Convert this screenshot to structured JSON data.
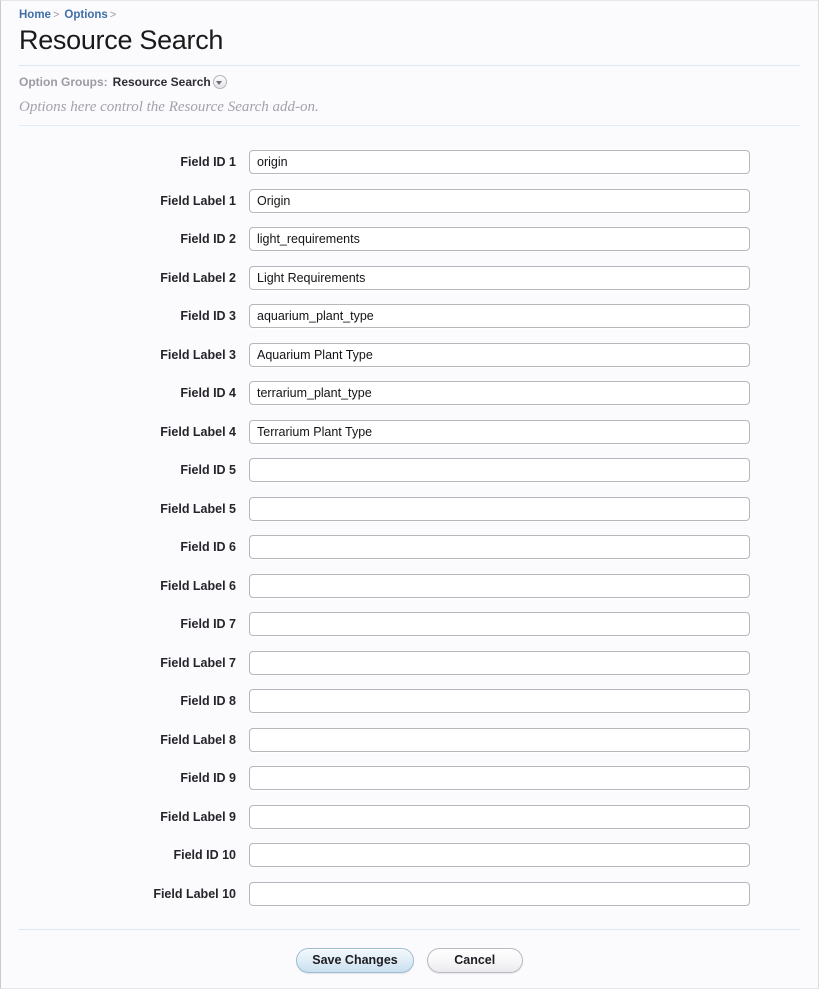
{
  "breadcrumb": {
    "items": [
      {
        "label": "Home",
        "separator": ">"
      },
      {
        "label": "Options",
        "separator": ">"
      }
    ]
  },
  "header": {
    "title": "Resource Search"
  },
  "option_groups": {
    "label": "Option Groups:",
    "selected": "Resource Search",
    "dropdown_icon": "chevron-down-circle-icon"
  },
  "description": "Options here control the Resource Search add-on.",
  "form": {
    "rows": [
      {
        "label": "Field ID 1",
        "value": "origin"
      },
      {
        "label": "Field Label 1",
        "value": "Origin"
      },
      {
        "label": "Field ID 2",
        "value": "light_requirements"
      },
      {
        "label": "Field Label 2",
        "value": "Light Requirements"
      },
      {
        "label": "Field ID 3",
        "value": "aquarium_plant_type"
      },
      {
        "label": "Field Label 3",
        "value": "Aquarium Plant Type"
      },
      {
        "label": "Field ID 4",
        "value": "terrarium_plant_type"
      },
      {
        "label": "Field Label 4",
        "value": "Terrarium Plant Type"
      },
      {
        "label": "Field ID 5",
        "value": ""
      },
      {
        "label": "Field Label 5",
        "value": ""
      },
      {
        "label": "Field ID 6",
        "value": ""
      },
      {
        "label": "Field Label 6",
        "value": ""
      },
      {
        "label": "Field ID 7",
        "value": ""
      },
      {
        "label": "Field Label 7",
        "value": ""
      },
      {
        "label": "Field ID 8",
        "value": ""
      },
      {
        "label": "Field Label 8",
        "value": ""
      },
      {
        "label": "Field ID 9",
        "value": ""
      },
      {
        "label": "Field Label 9",
        "value": ""
      },
      {
        "label": "Field ID 10",
        "value": ""
      },
      {
        "label": "Field Label 10",
        "value": ""
      }
    ]
  },
  "actions": {
    "save_label": "Save Changes",
    "cancel_label": "Cancel"
  },
  "colors": {
    "link": "#3f6ea8",
    "rule": "#d7eaf5",
    "background": "#fbfbfe",
    "primary_button": "#c9e0ef",
    "text": "#1a1a1a",
    "muted_text": "#a2a2ac"
  }
}
